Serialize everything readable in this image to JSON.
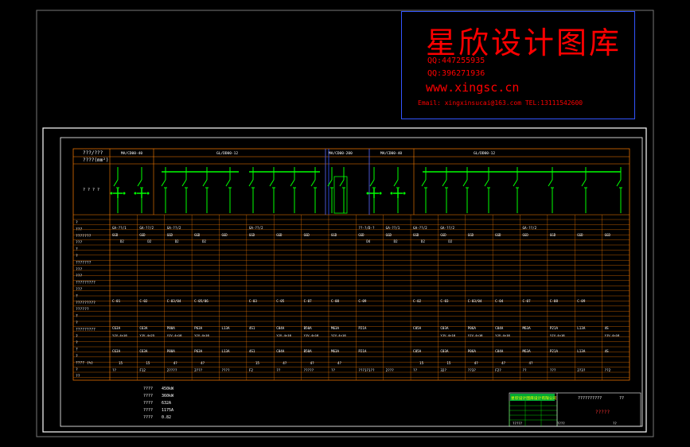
{
  "watermark": {
    "title": "星欣设计图库",
    "qq1": "QQ:447255935",
    "qq2": "QQ:396271936",
    "url": "www.xingsc.cn",
    "email": "Email: xingxinsucai@163.com  TEL:13111542600"
  },
  "colors": {
    "frame": "#ffffff",
    "grid": "#ff7f00",
    "text": "#ffffff",
    "breaker": "#00ff00",
    "watermark": "#ff0000",
    "watermark_border": "#3355ff",
    "title_block": "#00ff00"
  },
  "header": {
    "row1_label": "???/???",
    "row2_label": "????(mm²)",
    "row3_label": "? ? ? ?"
  },
  "row_labels": [
    "?",
    "???",
    "???????",
    "???",
    "?",
    "?",
    "???????",
    "???",
    "???",
    "?????????",
    "???",
    "?",
    "?????????",
    "??????",
    "?",
    "?",
    "?????????",
    "?",
    "?",
    "?",
    "?",
    "???? (%)",
    "?",
    "??"
  ],
  "columns": [
    {
      "bus": "MA/CD00-40",
      "panel": "GA-??/1",
      "type": "GGD",
      "value": "D2"
    },
    {
      "bus": "",
      "panel": "GA-??/2",
      "type": "GGD",
      "value": "D2"
    },
    {
      "bus": "GL/DD00-12",
      "panel": "GA-??/2",
      "type": "GGD",
      "value": "D2"
    },
    {
      "bus": "",
      "panel": "",
      "type": "GGD",
      "value": "D2"
    },
    {
      "bus": "",
      "panel": "",
      "type": "GGD",
      "value": ""
    },
    {
      "bus": "",
      "panel": "GA-??/2",
      "type": "GGD",
      "value": ""
    },
    {
      "bus": "",
      "panel": "",
      "type": "GGD",
      "value": ""
    },
    {
      "bus": "",
      "panel": "",
      "type": "GGD",
      "value": ""
    },
    {
      "bus": "",
      "panel": "",
      "type": "GGD",
      "value": ""
    },
    {
      "bus": "MA/CD00-200",
      "panel": "??-?/D-?",
      "type": "GGD",
      "value": "D4"
    },
    {
      "bus": "MA/CD00-40",
      "panel": "GA-??/1",
      "type": "GGD",
      "value": "D2"
    },
    {
      "bus": "",
      "panel": "GA-??/2",
      "type": "GGD",
      "value": "D2"
    },
    {
      "bus": "GL/DD00-12",
      "panel": "GA-??/2",
      "type": "GGD",
      "value": "D2"
    },
    {
      "bus": "",
      "panel": "",
      "type": "GGD",
      "value": ""
    },
    {
      "bus": "",
      "panel": "",
      "type": "GGD",
      "value": ""
    },
    {
      "bus": "",
      "panel": "GA-??/2",
      "type": "GGD",
      "value": ""
    },
    {
      "bus": "",
      "panel": "",
      "type": "GGD",
      "value": ""
    },
    {
      "bus": "",
      "panel": "",
      "type": "GGD",
      "value": ""
    },
    {
      "bus": "",
      "panel": "",
      "type": "GGD",
      "value": ""
    }
  ],
  "circuit_ids": [
    "C-01",
    "C-02",
    "C-03/04",
    "C-05/06",
    "",
    "C-03",
    "C-05",
    "C-07",
    "C-08",
    "C-09",
    "",
    "C-02",
    "C-03",
    "C-03/04",
    "C-04",
    "C-07",
    "C-08",
    "C-09",
    ""
  ],
  "breaker_ratings": [
    "C63A",
    "C63A",
    "P80A",
    "P63A",
    "L13A",
    "4S1",
    "C04A",
    "B50A",
    "M63A",
    "P21A",
    "",
    "C05A",
    "C03A",
    "P06A",
    "C04A",
    "M63A",
    "P21A",
    "L13A",
    "4S",
    "4S"
  ],
  "cable_specs": [
    "YJV-4×16",
    "YJV-4×25",
    "YJV-4×16",
    "YJV-4×16",
    "",
    "",
    "YJV-4×16",
    "YJV-4×16",
    "YJV-4×16",
    "",
    "",
    "",
    "YJV-4×16",
    "YJV-4×16",
    "YJV-4×16",
    "",
    "YJV-4×16",
    "",
    "YJV-4×16"
  ],
  "bottom_codes": [
    "??",
    "F12",
    "2????",
    "2???",
    "????",
    "F2",
    "??",
    "?????",
    "??",
    "???1?1??",
    "2???",
    "??",
    "32?",
    "??3?",
    "F2?",
    "??",
    "???",
    "2?3?",
    "??2",
    "??2"
  ],
  "percent_row": [
    "15",
    "15",
    "4?",
    "4?",
    "",
    "15",
    "4?",
    "4?",
    "4?",
    "",
    "",
    "15",
    "15",
    "4?",
    "4?",
    "4?",
    "",
    "",
    "",
    "4.3",
    ""
  ],
  "totals_label": "?????",
  "summary": [
    {
      "label": "????",
      "value": "450kW"
    },
    {
      "label": "????",
      "value": "360kW"
    },
    {
      "label": "????",
      "value": "632A"
    },
    {
      "label": "????",
      "value": "1175A"
    },
    {
      "label": "????",
      "value": "0.82"
    }
  ],
  "title_block": {
    "company": "星欣设计图库设计有限公司",
    "drawing_title": "??????????",
    "drawing_no": "?????",
    "page": "??",
    "sheet": "?????",
    "date": "????",
    "scale": "??"
  }
}
